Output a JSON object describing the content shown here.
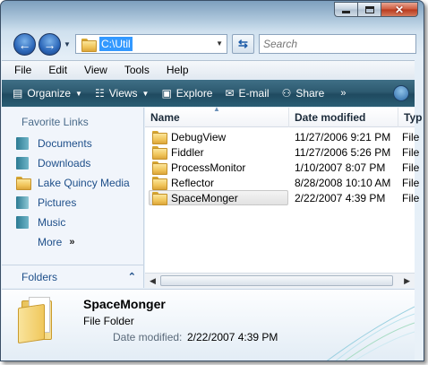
{
  "address": {
    "path": "C:\\Util"
  },
  "search": {
    "placeholder": "Search"
  },
  "menu": [
    "File",
    "Edit",
    "View",
    "Tools",
    "Help"
  ],
  "commands": {
    "organize": "Organize",
    "views": "Views",
    "explore": "Explore",
    "email": "E-mail",
    "share": "Share",
    "more": "»"
  },
  "nav": {
    "title": "Favorite Links",
    "links": [
      "Documents",
      "Downloads",
      "Lake Quincy Media",
      "Pictures",
      "Music"
    ],
    "more": "More",
    "more_arrows": "»",
    "folders": "Folders"
  },
  "columns": {
    "name": "Name",
    "date": "Date modified",
    "type": "Typ"
  },
  "files": [
    {
      "name": "DebugView",
      "date": "11/27/2006 9:21 PM",
      "type": "File"
    },
    {
      "name": "Fiddler",
      "date": "11/27/2006 5:26 PM",
      "type": "File"
    },
    {
      "name": "ProcessMonitor",
      "date": "1/10/2007 8:07 PM",
      "type": "File"
    },
    {
      "name": "Reflector",
      "date": "8/28/2008 10:10 AM",
      "type": "File"
    },
    {
      "name": "SpaceMonger",
      "date": "2/22/2007 4:39 PM",
      "type": "File"
    }
  ],
  "selected_index": 4,
  "details": {
    "name": "SpaceMonger",
    "type": "File Folder",
    "date_label": "Date modified:",
    "date_value": "2/22/2007 4:39 PM"
  },
  "colors": {
    "command_bar": "#2d5a70",
    "link": "#1e4f8a",
    "selection": "#3399ff"
  }
}
